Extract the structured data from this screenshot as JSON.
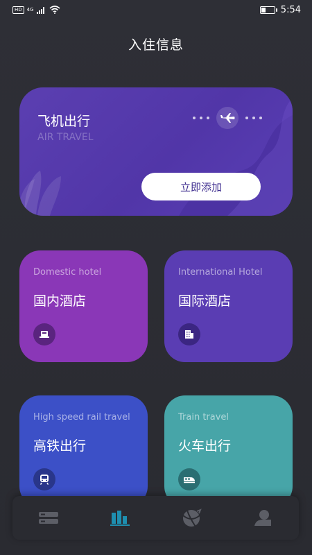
{
  "status_bar": {
    "hd": "HD",
    "network": "4G",
    "time": "5:54"
  },
  "header": {
    "title": "入住信息"
  },
  "air_travel": {
    "title": "飞机出行",
    "subtitle": "AIR TRAVEL",
    "button_label": "立即添加",
    "icon": "airplane-icon"
  },
  "cards": [
    {
      "en": "Domestic hotel",
      "zh": "国内酒店",
      "icon": "hotel-bed-icon",
      "color": "#8a37b7"
    },
    {
      "en": "International Hotel",
      "zh": "国际酒店",
      "icon": "building-icon",
      "color": "#5a3db3"
    },
    {
      "en": "High speed rail travel",
      "zh": "高铁出行",
      "icon": "train-front-icon",
      "color": "#3c50c7"
    },
    {
      "en": "Train travel",
      "zh": "火车出行",
      "icon": "bullet-train-icon",
      "color": "#47a5a8"
    }
  ],
  "tabbar": {
    "items": [
      {
        "icon": "list-icon",
        "active": false
      },
      {
        "icon": "building-chart-icon",
        "active": true
      },
      {
        "icon": "globe-icon",
        "active": false
      },
      {
        "icon": "profile-icon",
        "active": false
      }
    ],
    "active_color": "#1e8fb0",
    "inactive_color": "#5c5e66"
  }
}
